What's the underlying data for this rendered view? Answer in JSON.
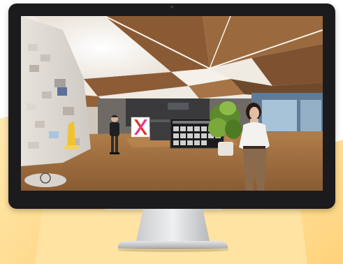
{
  "scene": {
    "signboard_letter": "X",
    "colors": {
      "background_blob": "#ffd98a",
      "bezel": "#1b1b1d",
      "ceiling_wood": "#8a5a34",
      "ceiling_light": "#f1ede6",
      "floor": "#9a6a3c",
      "accent_yellow": "#f2c230",
      "signboard_red": "#e2322c"
    }
  }
}
